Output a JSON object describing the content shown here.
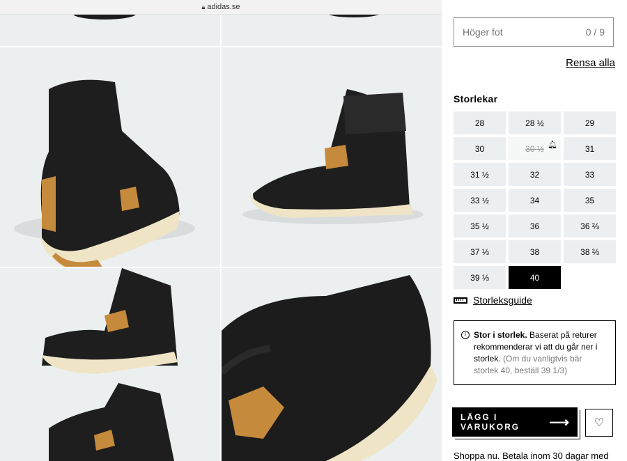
{
  "browser": {
    "url": "adidas.se"
  },
  "panel": {
    "foot_label": "Höger fot",
    "foot_count": "0 / 9",
    "clear_all": "Rensa alla",
    "sizes_title": "Storlekar",
    "sizes": [
      {
        "label": "28",
        "state": "available"
      },
      {
        "label": "28 ½",
        "state": "available"
      },
      {
        "label": "29",
        "state": "available"
      },
      {
        "label": "30",
        "state": "available"
      },
      {
        "label": "30 ½",
        "state": "unavailable"
      },
      {
        "label": "31",
        "state": "available"
      },
      {
        "label": "31 ½",
        "state": "available"
      },
      {
        "label": "32",
        "state": "available"
      },
      {
        "label": "33",
        "state": "available"
      },
      {
        "label": "33 ½",
        "state": "available"
      },
      {
        "label": "34",
        "state": "available"
      },
      {
        "label": "35",
        "state": "available"
      },
      {
        "label": "35 ½",
        "state": "available"
      },
      {
        "label": "36",
        "state": "available"
      },
      {
        "label": "36 ⅔",
        "state": "available"
      },
      {
        "label": "37 ⅓",
        "state": "available"
      },
      {
        "label": "38",
        "state": "available"
      },
      {
        "label": "38 ⅔",
        "state": "available"
      },
      {
        "label": "39 ⅓",
        "state": "available"
      },
      {
        "label": "40",
        "state": "selected"
      }
    ],
    "size_guide": "Storleksguide",
    "info_bold": "Stor i storlek.",
    "info_text": " Baserat på returer rekommenderar vi att du går ner i storlek.",
    "info_muted": " (Om du vanligtvis bär storlek 40, beställ 39 1/3)",
    "add_to_cart": "LÄGG I VARUKORG",
    "shop_text": "Shoppa nu. Betala inom 30 dagar med"
  },
  "icons": {
    "lock": "lock-icon",
    "ruler": "ruler-icon",
    "info": "info-icon",
    "arrow": "arrow-right-icon",
    "heart": "heart-icon",
    "bell": "bell-icon"
  },
  "colors": {
    "selected_bg": "#000000",
    "size_bg": "#eceff1",
    "tile_bg": "#eceff0"
  }
}
